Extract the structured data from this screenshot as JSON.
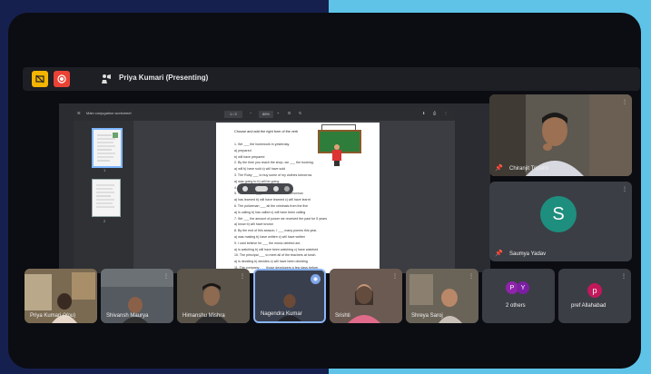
{
  "colors": {
    "accent_left": "#16204e",
    "accent_right": "#5fc3e8",
    "presenting_border": "#8ab4f8",
    "avatar_green": "#1e8e7e",
    "avatar_pink": "#c2185b",
    "avatar_purple": "#8e24aa"
  },
  "topbar": {
    "presenter_label": "Priya Kumari (Presenting)",
    "icons": [
      "no-screen-icon",
      "record-icon",
      "presentation-icon"
    ]
  },
  "viewer": {
    "file_name": "Main conjugation worksheet",
    "page_indicator": "1 / 2",
    "zoom_level": "88%",
    "thumb_page_numbers": [
      "1",
      "2"
    ]
  },
  "document": {
    "instruction": "Choose and add the right form of the verb",
    "lines": [
      "1. We ___ the homework in yesterday.",
      "   a) prepared",
      "   b) will have prepared",
      "2. By the time you reach the shop, we ___ the booking.",
      "   a) will          b) have sold          c) will have sold",
      "3. The Ruby ___ to buy some of my clothes tomorrow.",
      "   a) was going to     b) will be going",
      "4. ___ we ___ tomorrow?",
      "5. The teacher ___ the math test next tomorrow.",
      "   a) has learned     b) will have learned     c) will have learnt",
      "6. The policeman ___ all the criminals from the five",
      "   a) is calling      b) has called      c) will have been calling",
      "7. We ___ the amount of power we received the past for 5 years",
      "   a) know           b) will have known",
      "8. By the end of this season, I ___ many poems this year.",
      "   a) was making      b) have written      c) will have written",
      "9. I cant believe he ___ the music deleted act.",
      "   a) is watching     b) will have been watching     c) have watched",
      "10. The principal ___ to meet all of the teachers at lunch.",
      "   a) is deciding     b) decides     c) will have been deciding",
      "11. The company ___ those developers a few days before."
    ]
  },
  "tiles": {
    "right_top": {
      "name": "Chiranjit Tripathi"
    },
    "right_bottom": {
      "name": "Saumya Yadav",
      "initial": "S"
    },
    "bottom": [
      {
        "name": "Priya Kumari (You)"
      },
      {
        "name": "Shivansh Maurya"
      },
      {
        "name": "Himanshu Mishra"
      },
      {
        "name": "Nagendra Kumar"
      },
      {
        "name": "Srishti"
      },
      {
        "name": "Shreya Saroj"
      },
      {
        "name": "2 others",
        "initials": [
          "P",
          "Y"
        ]
      },
      {
        "name": "pref Allahabad",
        "initial": "p"
      }
    ]
  }
}
